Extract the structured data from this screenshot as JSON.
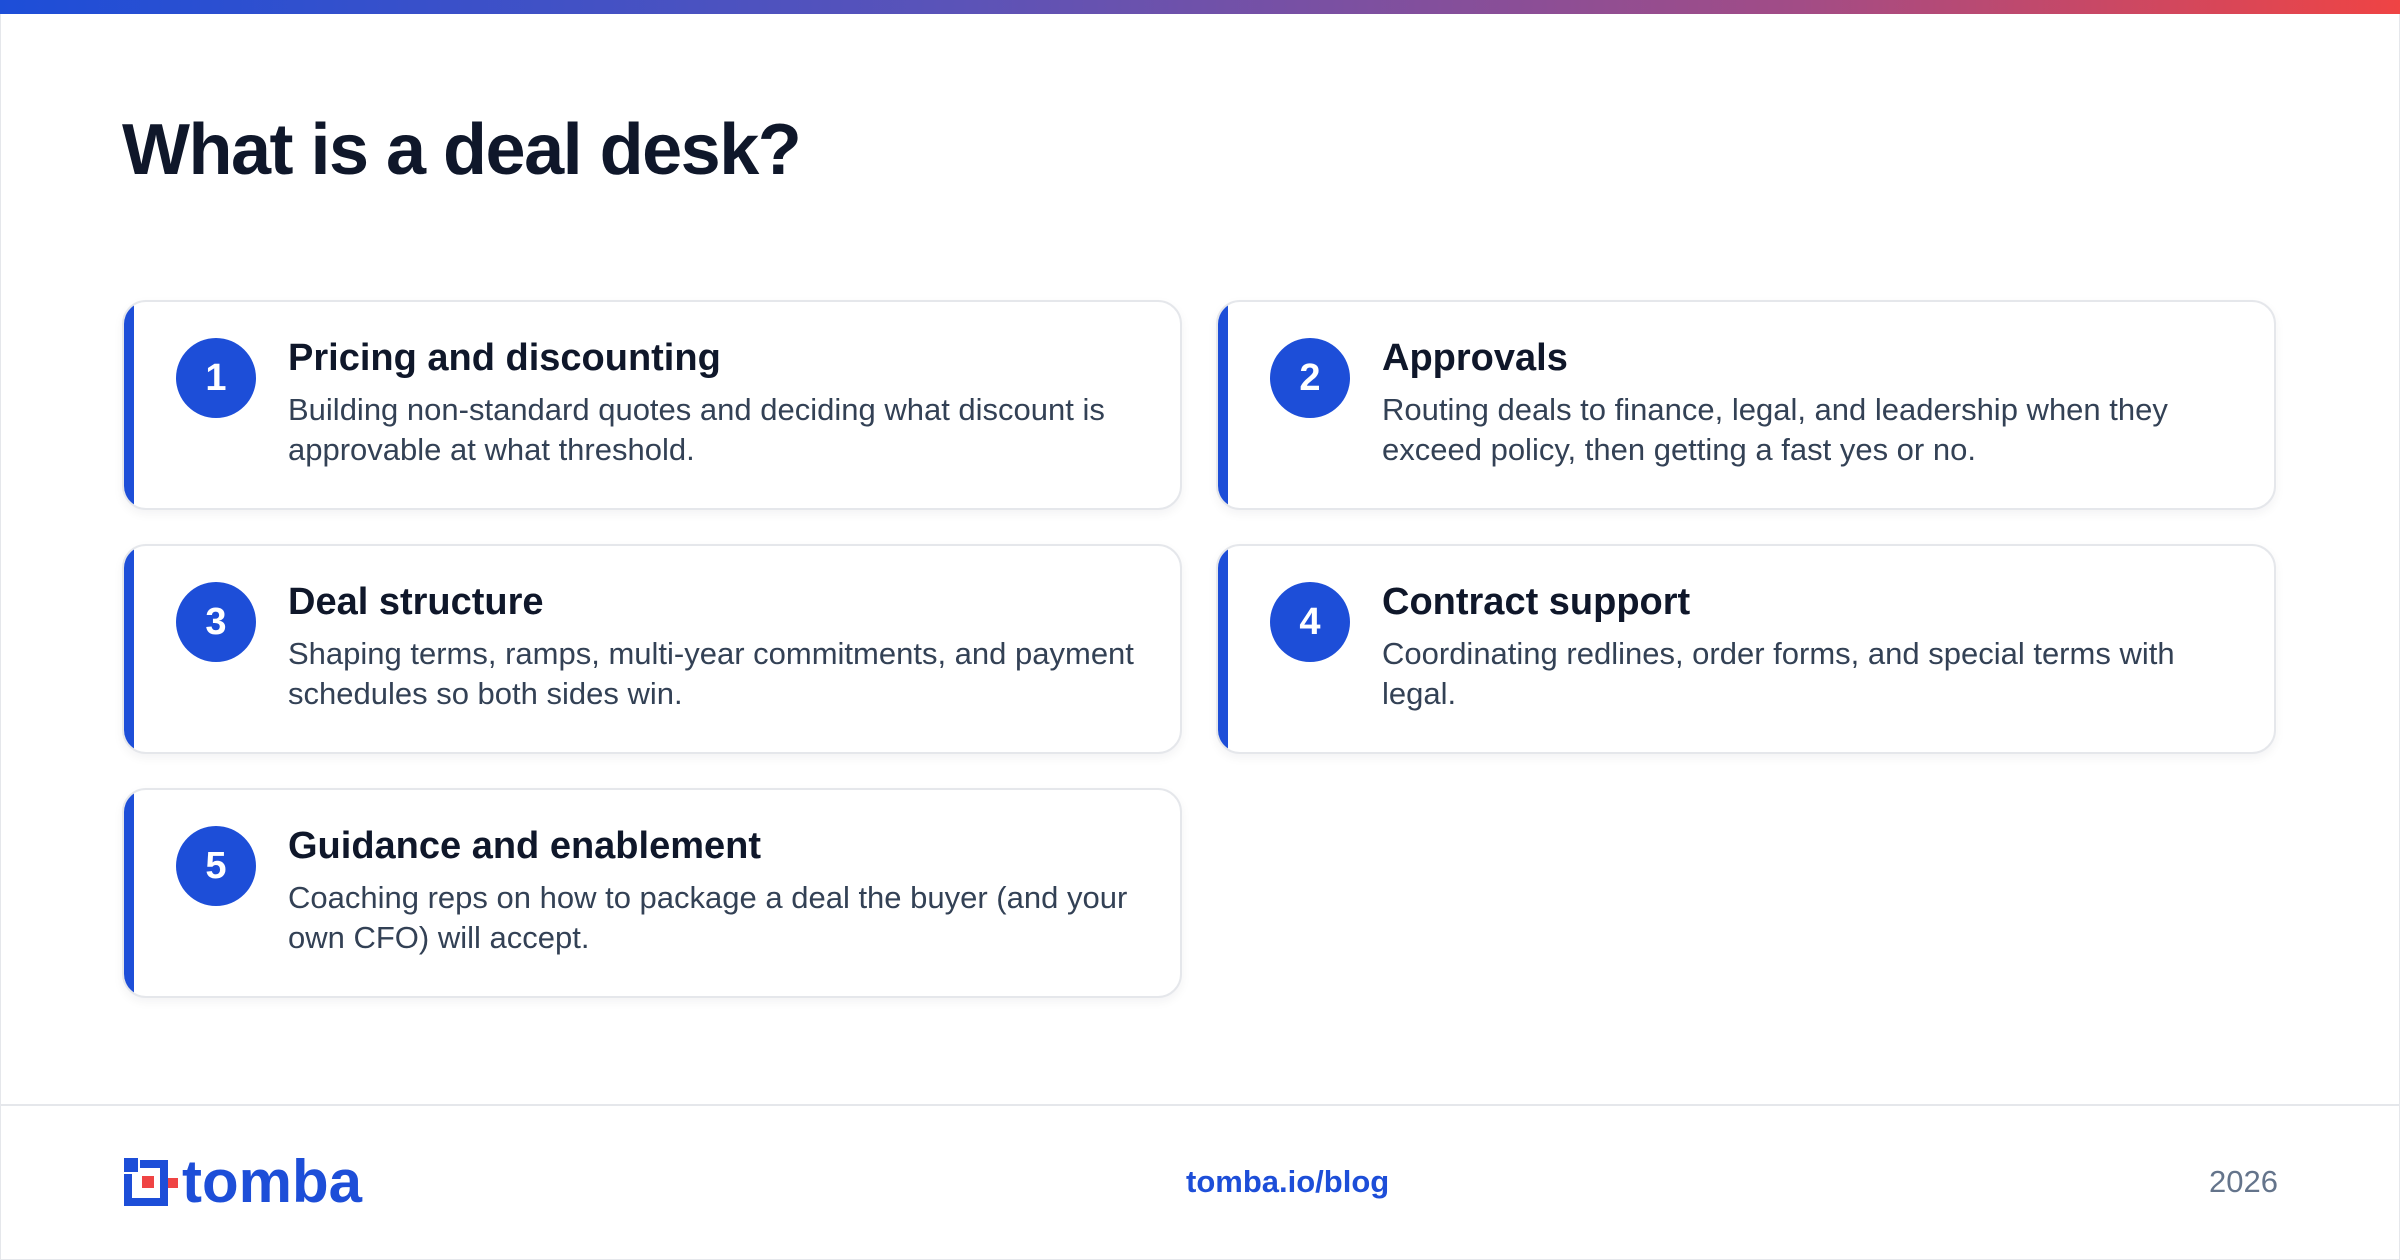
{
  "header": {
    "title": "What is a deal desk?"
  },
  "colors": {
    "accent": "#1d4ed8",
    "text": "#0f172a",
    "muted": "#334155",
    "gradient_end": "#ef4444"
  },
  "cards": [
    {
      "number": "1",
      "title": "Pricing and discounting",
      "description": "Building non-standard quotes and deciding what discount is approvable at what threshold."
    },
    {
      "number": "2",
      "title": "Approvals",
      "description": "Routing deals to finance, legal, and leadership when they exceed policy, then getting a fast yes or no."
    },
    {
      "number": "3",
      "title": "Deal structure",
      "description": "Shaping terms, ramps, multi-year commitments, and payment schedules so both sides win."
    },
    {
      "number": "4",
      "title": "Contract support",
      "description": "Coordinating redlines, order forms, and special terms with legal."
    },
    {
      "number": "5",
      "title": "Guidance and enablement",
      "description": "Coaching reps on how to package a deal the buyer (and your own CFO) will accept."
    }
  ],
  "footer": {
    "logo_text": "tomba",
    "logo_icon": "tomba-logo-mark",
    "link": "tomba.io/blog",
    "year": "2026"
  }
}
